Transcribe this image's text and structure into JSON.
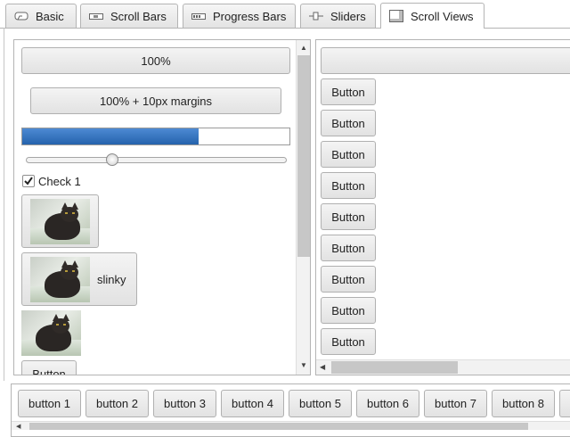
{
  "tabs": [
    {
      "label": "Basic",
      "icon": "basic-icon"
    },
    {
      "label": "Scroll Bars",
      "icon": "scrollbar-icon"
    },
    {
      "label": "Progress Bars",
      "icon": "progressbar-icon"
    },
    {
      "label": "Sliders",
      "icon": "slider-icon"
    },
    {
      "label": "Scroll Views",
      "icon": "scrollview-icon",
      "active": true
    }
  ],
  "left_panel": {
    "btn_full": "100%",
    "btn_margins": "100% + 10px margins",
    "progress_fraction": 0.66,
    "slider_fraction": 0.33,
    "check_label": "Check 1",
    "checked": true,
    "image_button_label": "slinky",
    "partial_button": "Button"
  },
  "right_panel": {
    "buttons": [
      "Button",
      "Button",
      "Button",
      "Button",
      "Button",
      "Button",
      "Button",
      "Button",
      "Button"
    ]
  },
  "bottom_bar": {
    "buttons": [
      "button 1",
      "button 2",
      "button 3",
      "button 4",
      "button 5",
      "button 6",
      "button 7",
      "button 8"
    ]
  },
  "colors": {
    "accent": "#2f6fbf",
    "tab_border": "#b4b4b4",
    "button_face": "#e8e8e8"
  }
}
